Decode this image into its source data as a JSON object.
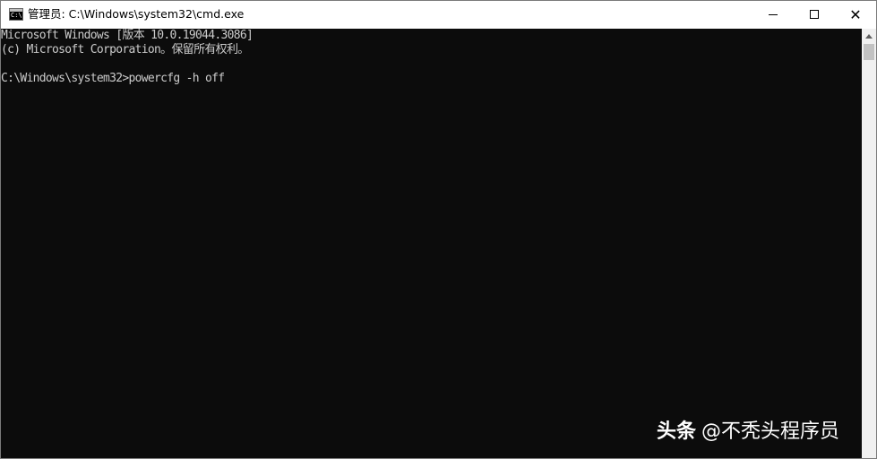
{
  "window": {
    "title": "管理员: C:\\Windows\\system32\\cmd.exe",
    "app_icon_glyph": "C:\\."
  },
  "console": {
    "lines": [
      "Microsoft Windows [版本 10.0.19044.3086]",
      "(c) Microsoft Corporation。保留所有权利。",
      "C:\\Windows\\system32>powercfg -h off"
    ]
  },
  "controls": {
    "minimize_icon": "minimize-icon",
    "maximize_icon": "maximize-icon",
    "close_icon": "close-icon",
    "close_glyph": "✕"
  },
  "watermark": {
    "brand": "头条",
    "handle": "@不秃头程序员"
  }
}
